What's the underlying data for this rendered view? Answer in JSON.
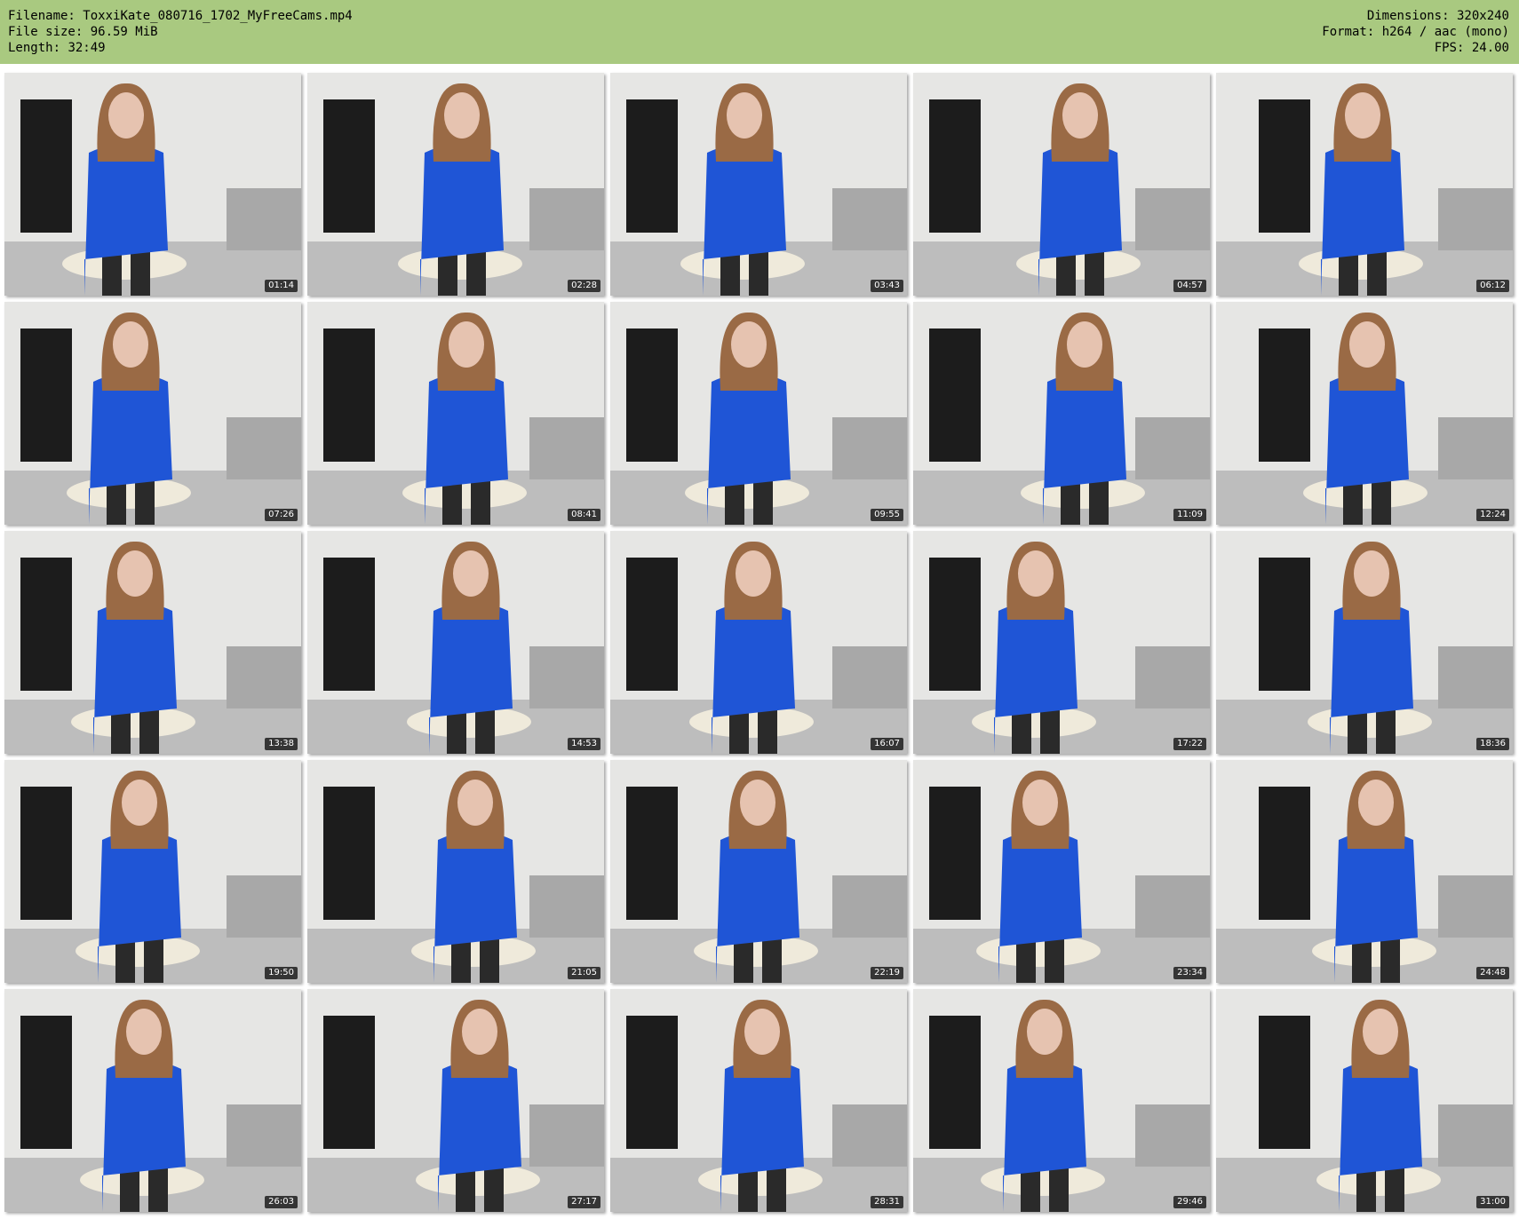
{
  "header": {
    "filename_label": "Filename: ",
    "filename": "ToxxiKate_080716_1702_MyFreeCams.mp4",
    "filesize_label": "File size: ",
    "filesize": "96.59 MiB",
    "length_label": "Length: ",
    "length": "32:49",
    "dimensions_label": "Dimensions: ",
    "dimensions": "320x240",
    "format_label": "Format: ",
    "format": "h264 / aac (mono)",
    "fps_label": "FPS: ",
    "fps": "24.00"
  },
  "colors": {
    "header_bg": "#a9c980",
    "dress": "#1f55d6",
    "wall": "#e6e6e4",
    "floor": "#bdbdbd",
    "door": "#1c1c1c",
    "chair": "#efeadb",
    "sofa": "#a8a8a8",
    "hair": "#9a6a45",
    "skin": "#e6c3b0",
    "stockings": "#2a2a2a"
  },
  "thumbnails": [
    {
      "time": "01:14"
    },
    {
      "time": "02:28"
    },
    {
      "time": "03:43"
    },
    {
      "time": "04:57"
    },
    {
      "time": "06:12"
    },
    {
      "time": "07:26"
    },
    {
      "time": "08:41"
    },
    {
      "time": "09:55"
    },
    {
      "time": "11:09"
    },
    {
      "time": "12:24"
    },
    {
      "time": "13:38"
    },
    {
      "time": "14:53"
    },
    {
      "time": "16:07"
    },
    {
      "time": "17:22"
    },
    {
      "time": "18:36"
    },
    {
      "time": "19:50"
    },
    {
      "time": "21:05"
    },
    {
      "time": "22:19"
    },
    {
      "time": "23:34"
    },
    {
      "time": "24:48"
    },
    {
      "time": "26:03"
    },
    {
      "time": "27:17"
    },
    {
      "time": "28:31"
    },
    {
      "time": "29:46"
    },
    {
      "time": "31:00"
    }
  ]
}
